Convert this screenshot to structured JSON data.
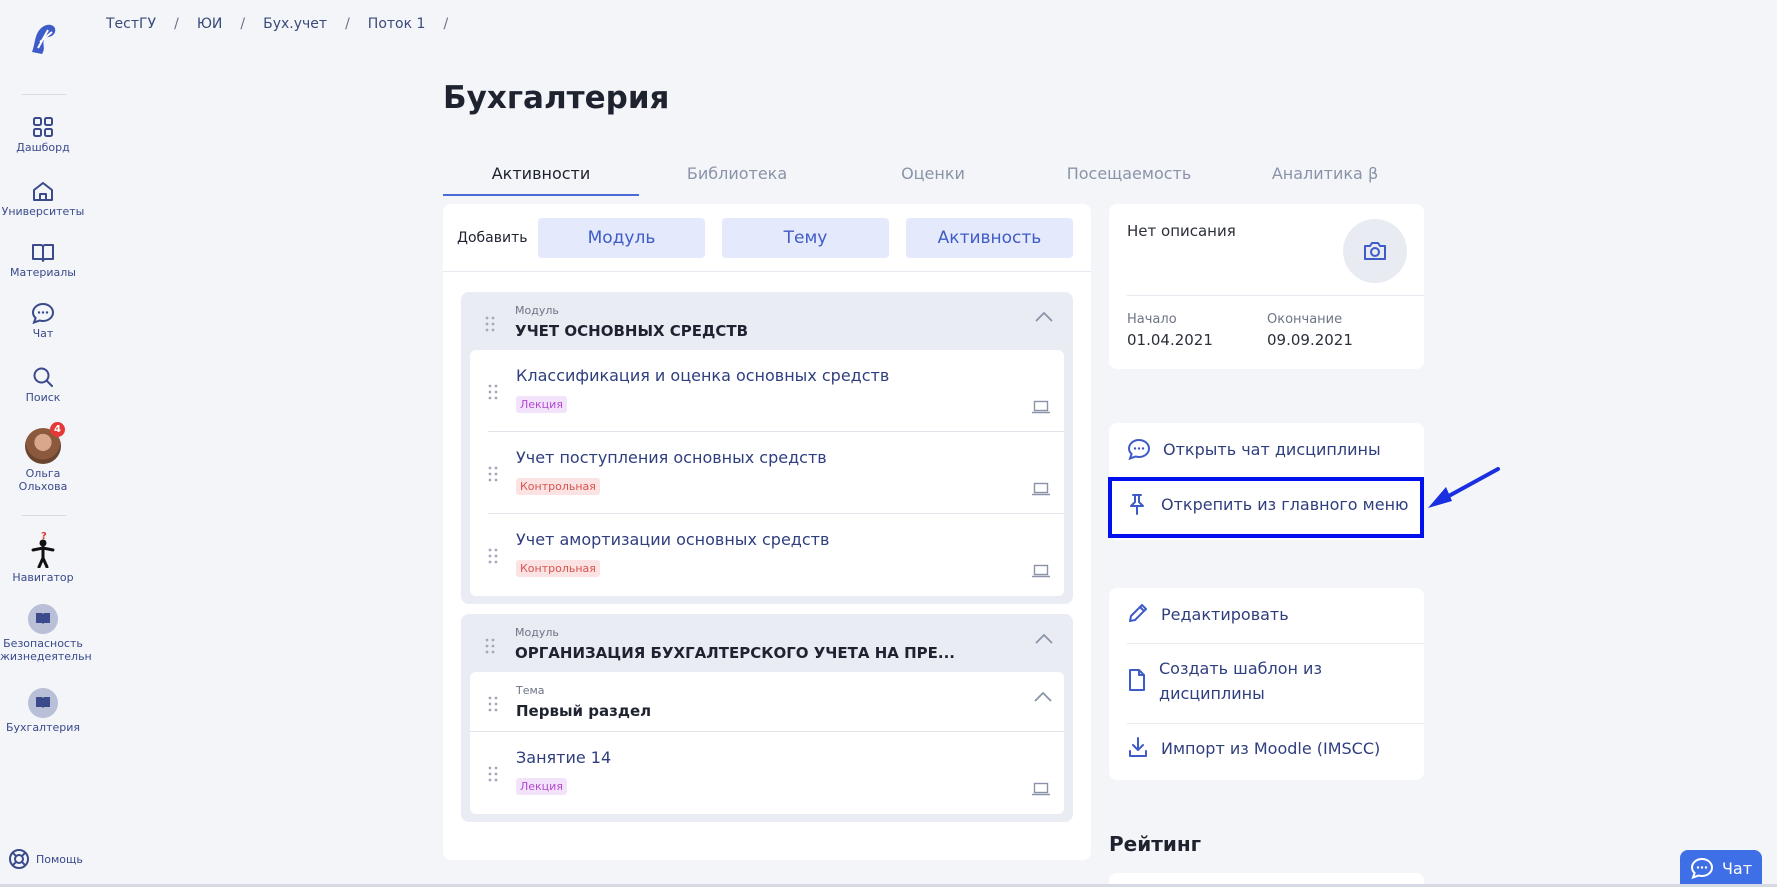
{
  "breadcrumb": [
    "ТестГУ",
    "ЮИ",
    "Бух.учет",
    "Поток 1"
  ],
  "sidebar": {
    "items": [
      {
        "label": "Дашборд"
      },
      {
        "label": "Университеты"
      },
      {
        "label": "Материалы"
      },
      {
        "label": "Чат"
      },
      {
        "label": "Поиск"
      }
    ],
    "user": {
      "first": "Ольга",
      "last": "Ольхова",
      "badge": "4"
    },
    "navigator": "Навигатор",
    "courses": [
      {
        "line1": "Безопасность",
        "line2": "жизнедеятельн"
      },
      {
        "line1": "Бухгалтерия",
        "line2": ""
      }
    ],
    "help": "Помощь"
  },
  "page": {
    "title": "Бухгалтерия"
  },
  "tabs": [
    "Активности",
    "Библиотека",
    "Оценки",
    "Посещаемость",
    "Аналитика β"
  ],
  "add_bar": {
    "label": "Добавить",
    "module": "Модуль",
    "topic": "Тему",
    "activity": "Активность"
  },
  "modules": [
    {
      "kicker": "Модуль",
      "title": "УЧЕТ ОСНОВНЫХ СРЕДСТВ",
      "activities": [
        {
          "title": "Классификация и оценка основных средств",
          "tag": "Лекция"
        },
        {
          "title": "Учет поступления основных средств",
          "tag": "Контрольная"
        },
        {
          "title": "Учет амортизации основных средств",
          "tag": "Контрольная"
        }
      ]
    },
    {
      "kicker": "Модуль",
      "title": "ОРГАНИЗАЦИЯ БУХГАЛТЕРСКОГО УЧЕТА НА ПРЕ...",
      "topic": {
        "kicker": "Тема",
        "title": "Первый раздел"
      },
      "activities": [
        {
          "title": "Занятие 14",
          "tag": "Лекция"
        }
      ]
    }
  ],
  "description": {
    "text": "Нет описания",
    "start_label": "Начало",
    "start_value": "01.04.2021",
    "end_label": "Окончание",
    "end_value": "09.09.2021"
  },
  "links": {
    "open_chat": "Открыть чат дисциплины",
    "unpin": "Открепить из главного меню"
  },
  "actions": {
    "edit": "Редактировать",
    "template_line1": "Создать шаблон из",
    "template_line2": "дисциплины",
    "import": "Импорт из Moodle (IMSCC)"
  },
  "rating": {
    "title": "Рейтинг"
  },
  "chat_fab": {
    "label": "Чат"
  },
  "colors": {
    "accent": "#3f5bc7",
    "highlight": "#0010ee",
    "lecture_tag": "#b04ad0",
    "control_tag": "#d9534f"
  }
}
